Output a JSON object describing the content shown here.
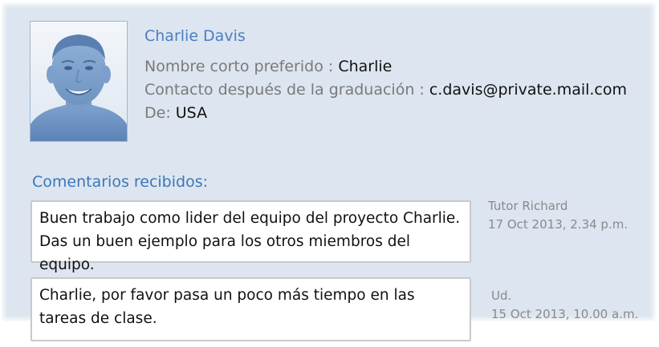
{
  "profile": {
    "name": "Charlie Davis",
    "preferred_name_label": "Nombre corto preferido : ",
    "preferred_name_value": "Charlie",
    "contact_label": "Contacto después de la graduación : ",
    "contact_value": "c.davis@private.mail.com",
    "from_label": "De: ",
    "from_value": "USA"
  },
  "comments": {
    "title": "Comentarios recibidos:",
    "items": [
      {
        "text": "Buen trabajo como lider del equipo del proyecto Charlie. Das un buen ejemplo para los otros miembros del equipo.",
        "author": "Tutor Richard",
        "date": "17 Oct 2013, 2.34 p.m."
      },
      {
        "text": "Charlie, por favor pasa un poco más tiempo en las tareas de clase.",
        "author": "Ud.",
        "date": "15 Oct 2013, 10.00 a.m."
      }
    ]
  },
  "colors": {
    "panel_background": "#dde5f0",
    "name_color": "#4a7fc1",
    "section_title_color": "#3a78b8",
    "label_gray": "#7a7a7a"
  },
  "icons": {
    "photo": "student-portrait-photo"
  }
}
